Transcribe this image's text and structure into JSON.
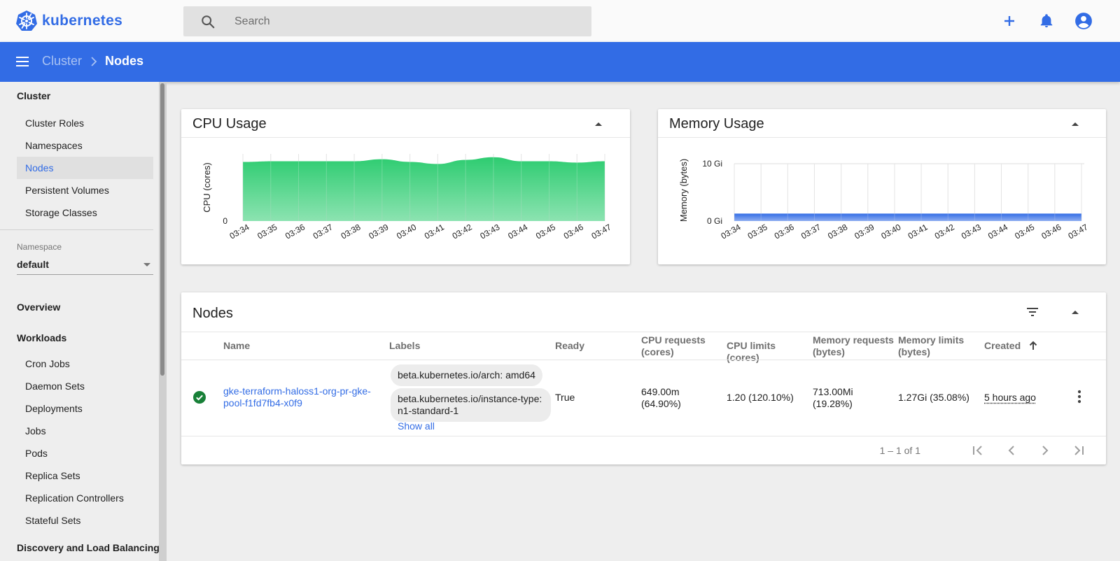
{
  "app": {
    "logo_text": "kubernetes"
  },
  "search": {
    "placeholder": "Search"
  },
  "icons": {
    "search": "search-icon",
    "create": "plus-icon",
    "notifications": "bell-icon",
    "account": "account-circle-icon",
    "menu": "hamburger-icon",
    "filter": "filter-icon",
    "status": "check-circle-icon",
    "more": "more-vert-icon"
  },
  "colors": {
    "accent": "#326ce5",
    "cpu_fill": "#2ecc71",
    "memory_fill": "#326ce5",
    "status_ok": "#188038"
  },
  "breadcrumb": {
    "parent": "Cluster",
    "current": "Nodes"
  },
  "sidebar": {
    "cluster_title": "Cluster",
    "cluster_items": [
      "Cluster Roles",
      "Namespaces",
      "Nodes",
      "Persistent Volumes",
      "Storage Classes"
    ],
    "active_item": "Nodes",
    "namespace_label": "Namespace",
    "namespace_value": "default",
    "overview": "Overview",
    "workloads_title": "Workloads",
    "workload_items": [
      "Cron Jobs",
      "Daemon Sets",
      "Deployments",
      "Jobs",
      "Pods",
      "Replica Sets",
      "Replication Controllers",
      "Stateful Sets"
    ],
    "discovery_title": "Discovery and Load Balancing"
  },
  "cpu_card": {
    "title": "CPU Usage"
  },
  "memory_card": {
    "title": "Memory Usage"
  },
  "chart_data": [
    {
      "type": "area",
      "ylabel": "CPU (cores)",
      "y_ticks": [
        "0"
      ],
      "x": [
        "03:34",
        "03:35",
        "03:36",
        "03:37",
        "03:38",
        "03:39",
        "03:40",
        "03:41",
        "03:42",
        "03:43",
        "03:44",
        "03:45",
        "03:46",
        "03:47"
      ],
      "values": [
        0.88,
        0.89,
        0.89,
        0.89,
        0.89,
        0.92,
        0.88,
        0.85,
        0.91,
        0.95,
        0.89,
        0.89,
        0.87,
        0.89
      ],
      "ylim": [
        0,
        1.0
      ],
      "grid": true,
      "color": "#2ecc71"
    },
    {
      "type": "area",
      "ylabel": "Memory (bytes)",
      "y_ticks": [
        "10 Gi",
        "0 Gi"
      ],
      "x": [
        "03:34",
        "03:35",
        "03:36",
        "03:37",
        "03:38",
        "03:39",
        "03:40",
        "03:41",
        "03:42",
        "03:43",
        "03:44",
        "03:45",
        "03:46",
        "03:47"
      ],
      "values": [
        1.3,
        1.3,
        1.3,
        1.3,
        1.3,
        1.3,
        1.3,
        1.3,
        1.3,
        1.3,
        1.3,
        1.3,
        1.3,
        1.3
      ],
      "ylim": [
        0,
        10
      ],
      "grid": true,
      "color": "#326ce5"
    }
  ],
  "nodes_card": {
    "title": "Nodes",
    "columns": {
      "name": "Name",
      "labels": "Labels",
      "ready": "Ready",
      "cpu_requests": "CPU requests (cores)",
      "cpu_limits": "CPU limits (cores)",
      "memory_requests": "Memory requests (bytes)",
      "memory_limits": "Memory limits (bytes)",
      "created": "Created"
    },
    "rows": [
      {
        "name": "gke-terraform-haloss1-org-pr-gke-pool-f1fd7fb4-x0f9",
        "labels": [
          "beta.kubernetes.io/arch: amd64",
          "beta.kubernetes.io/instance-type: n1-standard-1"
        ],
        "show_all": "Show all",
        "ready": "True",
        "cpu_requests": "649.00m (64.90%)",
        "cpu_limits": "1.20 (120.10%)",
        "memory_requests": "713.00Mi (19.28%)",
        "memory_limits": "1.27Gi (35.08%)",
        "created": "5 hours ago"
      }
    ],
    "pagination": "1 – 1 of 1"
  }
}
